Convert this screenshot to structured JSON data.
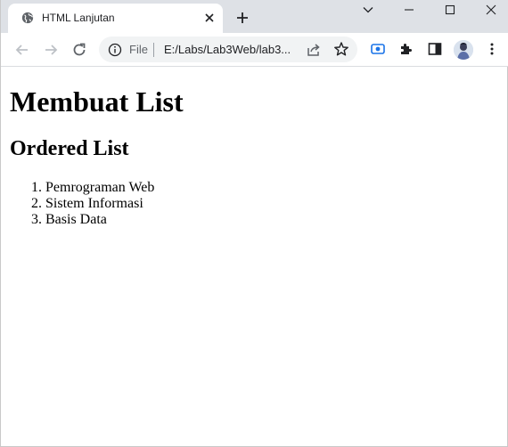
{
  "browser": {
    "tab": {
      "title": "HTML Lanjutan",
      "favicon": "globe-icon",
      "close": "close-icon"
    },
    "new_tab": "plus-icon",
    "window_controls": [
      "chevron-down-icon",
      "minimize-icon",
      "maximize-icon",
      "close-icon"
    ],
    "toolbar": {
      "back": "arrow-left-icon",
      "forward": "arrow-right-icon",
      "reload": "reload-icon",
      "address": {
        "info_icon": "info-icon",
        "scheme": "File",
        "url": "E:/Labs/Lab3Web/lab3..."
      },
      "share": "share-icon",
      "bookmark": "star-icon",
      "extensions": [
        "screen-capture-icon",
        "puzzle-icon",
        "side-panel-icon"
      ],
      "profile": "avatar",
      "menu": "more-vertical-icon"
    },
    "colors": {
      "tabstrip_bg": "#dee1e6",
      "omnibox_bg": "#f1f3f4",
      "accent_blue": "#1a73e8",
      "icon_gray": "#5f6368"
    }
  },
  "page": {
    "heading": "Membuat List",
    "subheading": "Ordered List",
    "ordered_list": [
      "Pemrograman Web",
      "Sistem Informasi",
      "Basis Data"
    ]
  }
}
